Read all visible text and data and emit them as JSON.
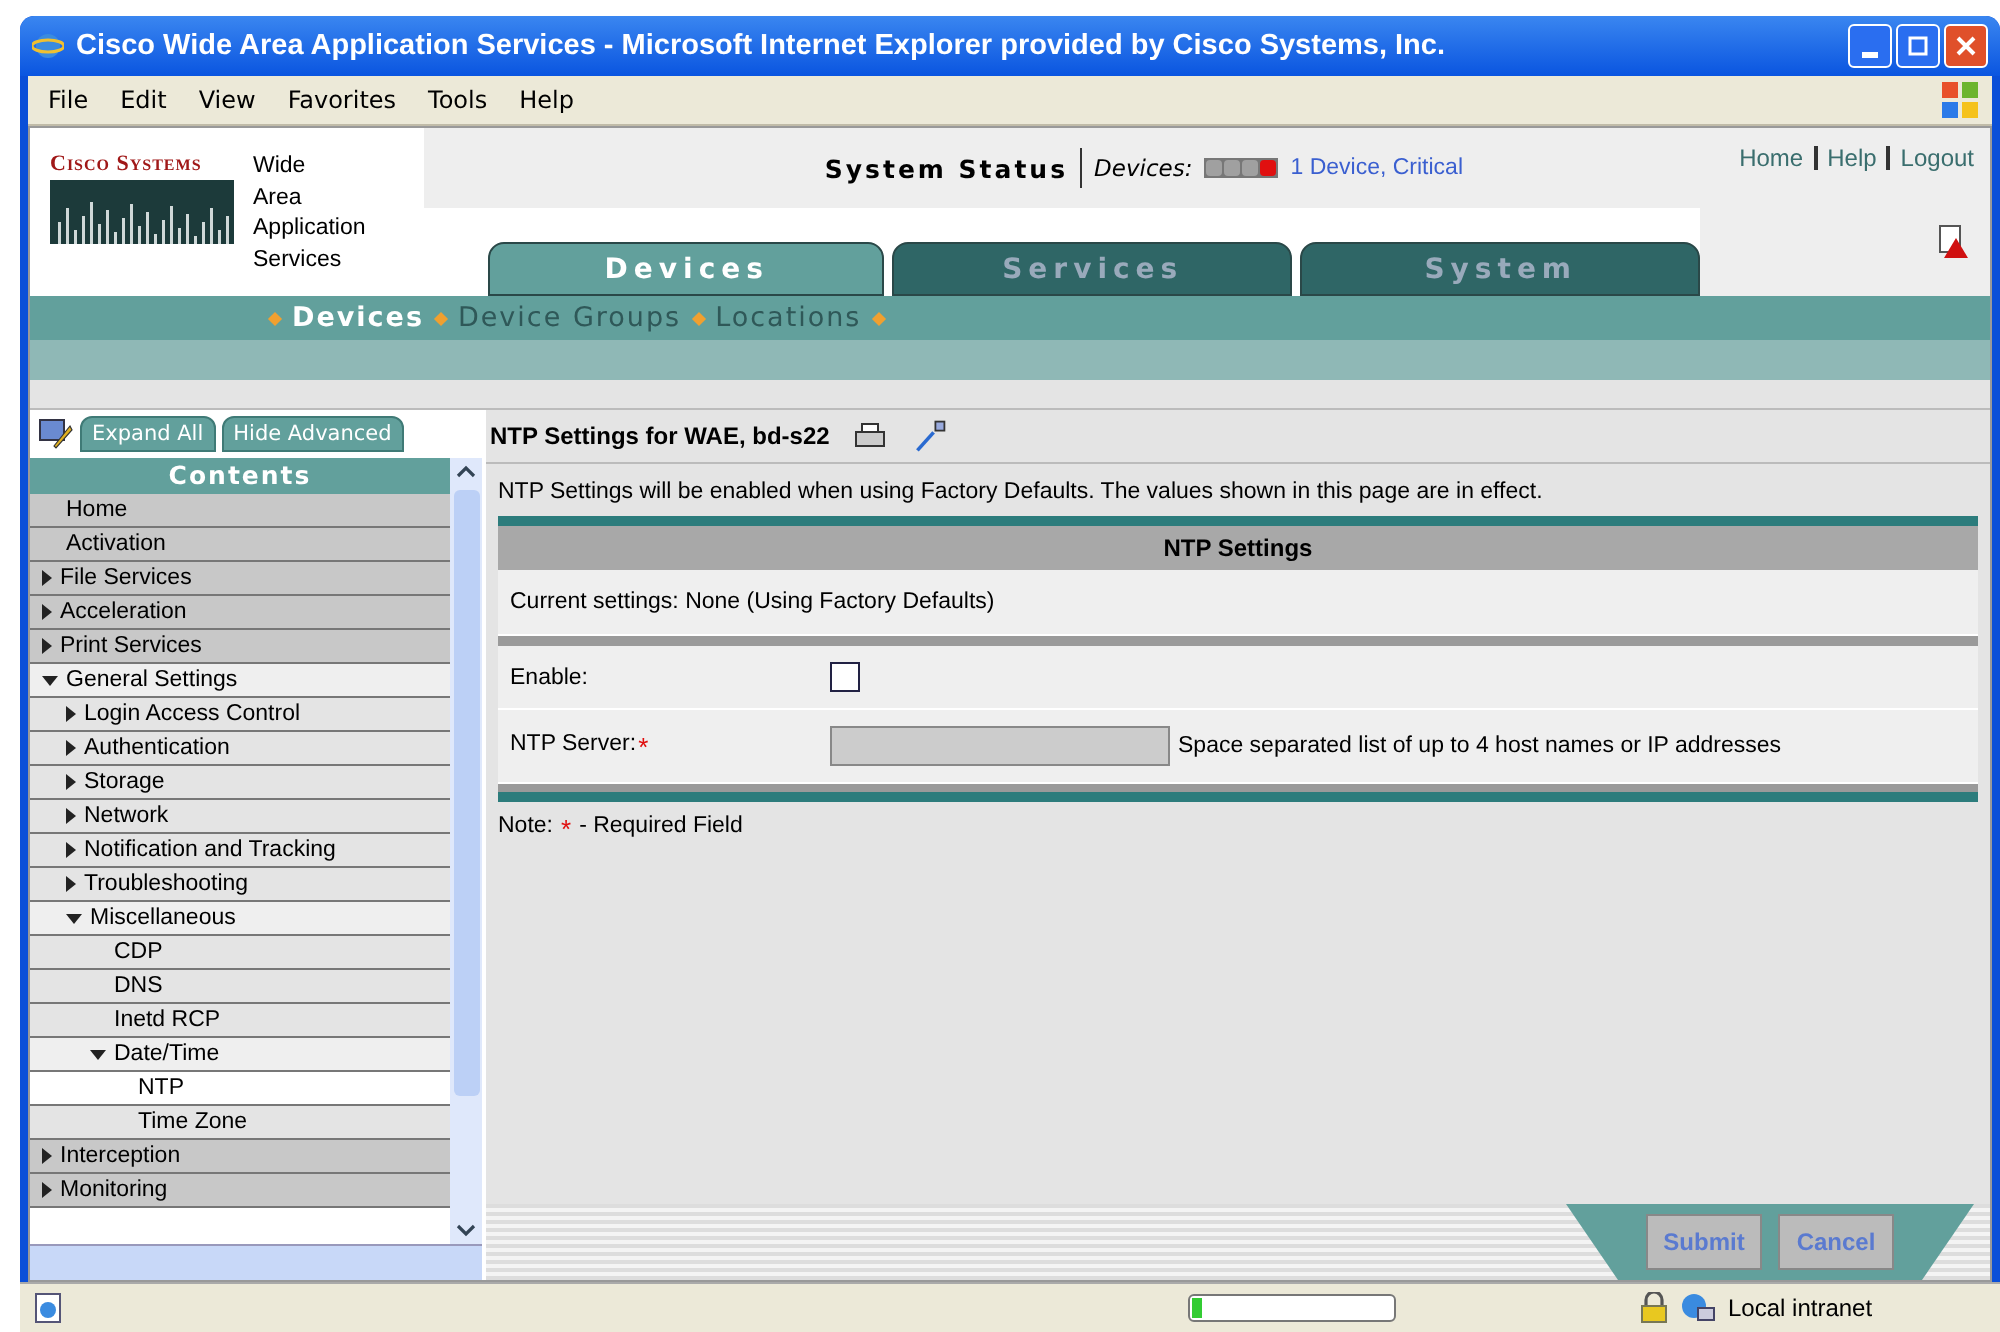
{
  "window": {
    "title": "Cisco Wide Area Application Services - Microsoft Internet Explorer provided by Cisco Systems, Inc."
  },
  "menu": [
    "File",
    "Edit",
    "View",
    "Favorites",
    "Tools",
    "Help"
  ],
  "header": {
    "brand": "Cisco Systems",
    "product": [
      "Wide",
      "Area",
      "Application",
      "Services"
    ],
    "status_label": "System Status",
    "devices_label": "Devices:",
    "status_dots": [
      {
        "color": "#a0a0a0"
      },
      {
        "color": "#a0a0a0"
      },
      {
        "color": "#a0a0a0"
      },
      {
        "color": "#e01010"
      }
    ],
    "status_link": "1 Device, Critical",
    "links": [
      "Home",
      "Help",
      "Logout"
    ]
  },
  "tabs": [
    {
      "label": "Devices",
      "selected": true
    },
    {
      "label": "Services",
      "selected": false
    },
    {
      "label": "System",
      "selected": false
    }
  ],
  "subnav": [
    {
      "label": "Devices",
      "selected": true
    },
    {
      "label": "Device Groups",
      "selected": false
    },
    {
      "label": "Locations",
      "selected": false
    }
  ],
  "sidebar": {
    "buttons": [
      "Expand All",
      "Hide Advanced"
    ],
    "title": "Contents",
    "items": [
      {
        "label": "Home",
        "selected": false
      },
      {
        "label": "Activation",
        "selected": false
      },
      {
        "label": "File Services",
        "selected": false,
        "expanded": false
      },
      {
        "label": "Acceleration",
        "selected": false,
        "expanded": false
      },
      {
        "label": "Print Services",
        "selected": false,
        "expanded": false
      },
      {
        "label": "General Settings",
        "selected": false,
        "expanded": true,
        "children": [
          {
            "label": "Login Access Control",
            "selected": false,
            "expanded": false
          },
          {
            "label": "Authentication",
            "selected": false,
            "expanded": false
          },
          {
            "label": "Storage",
            "selected": false,
            "expanded": false
          },
          {
            "label": "Network",
            "selected": false,
            "expanded": false
          },
          {
            "label": "Notification and Tracking",
            "selected": false,
            "expanded": false
          },
          {
            "label": "Troubleshooting",
            "selected": false,
            "expanded": false
          },
          {
            "label": "Miscellaneous",
            "selected": false,
            "expanded": true,
            "children": [
              {
                "label": "CDP",
                "selected": false
              },
              {
                "label": "DNS",
                "selected": false
              },
              {
                "label": "Inetd RCP",
                "selected": false
              },
              {
                "label": "Date/Time",
                "selected": false,
                "expanded": true,
                "children": [
                  {
                    "label": "NTP",
                    "selected": true
                  },
                  {
                    "label": "Time Zone",
                    "selected": false
                  }
                ]
              }
            ]
          }
        ]
      },
      {
        "label": "Interception",
        "selected": false,
        "expanded": false
      },
      {
        "label": "Monitoring",
        "selected": false,
        "expanded": false
      }
    ]
  },
  "content": {
    "title": "NTP Settings for WAE, bd-s22",
    "info": "NTP Settings will be enabled when using Factory Defaults. The values shown in this page are in effect.",
    "section": "NTP Settings",
    "current": "Current settings: None (Using Factory Defaults)",
    "enable": {
      "label": "Enable:",
      "checked": false
    },
    "server": {
      "label": "NTP Server:",
      "required": true,
      "mark": "*",
      "hint": "Space separated list of up to 4 host names or IP addresses"
    },
    "note": {
      "label": "Note:",
      "mark": "*",
      "text": "- Required Field"
    },
    "buttons": [
      "Submit",
      "Cancel"
    ]
  },
  "status_bar": {
    "progress": {
      "level": 0.05
    },
    "zone": "Local intranet"
  }
}
